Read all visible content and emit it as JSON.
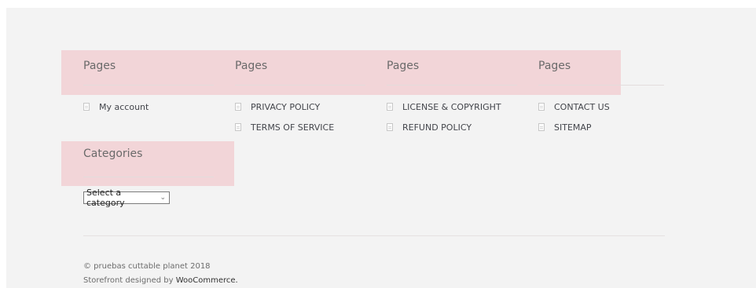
{
  "footer": {
    "page_columns": [
      {
        "title": "Pages",
        "items": [
          "My account"
        ]
      },
      {
        "title": "Pages",
        "items": [
          "PRIVACY POLICY",
          "TERMS OF SERVICE"
        ]
      },
      {
        "title": "Pages",
        "items": [
          "LICENSE & COPYRIGHT",
          "REFUND POLICY"
        ]
      },
      {
        "title": "Pages",
        "items": [
          "CONTACT US",
          "SITEMAP"
        ]
      }
    ],
    "categories": {
      "title": "Categories",
      "select_value": "Select a category"
    },
    "site_info": {
      "copyright": "© pruebas cuttable planet 2018",
      "designed_prefix": "Storefront designed by ",
      "designed_link": "WooCommerce."
    }
  },
  "colors": {
    "footer_bg": "#f3f3f3",
    "highlight_overlay": "#f2d5d8",
    "link_text": "#43454b"
  },
  "icons": {
    "page_item": "document-icon",
    "select_arrow": "chevron-down-icon"
  }
}
